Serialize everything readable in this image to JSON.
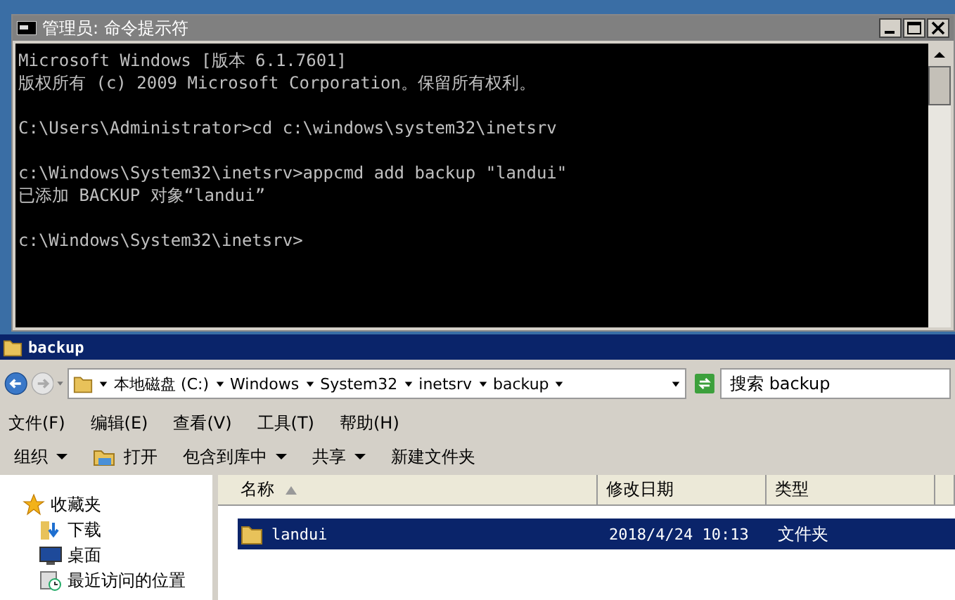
{
  "cmd_window": {
    "title": "管理员: 命令提示符",
    "blocks": [
      [
        "Microsoft Windows [版本 6.1.7601]",
        "版权所有 (c) 2009 Microsoft Corporation。保留所有权利。"
      ],
      [
        "C:\\Users\\Administrator>cd c:\\windows\\system32\\inetsrv"
      ],
      [
        "c:\\Windows\\System32\\inetsrv>appcmd add backup \"landui\"",
        "已添加 BACKUP 对象“landui”"
      ],
      [
        "c:\\Windows\\System32\\inetsrv>"
      ]
    ]
  },
  "explorer": {
    "title": "backup",
    "nav_buttons": [
      {
        "kind": "back",
        "disabled": false
      },
      {
        "kind": "forward",
        "disabled": true
      }
    ],
    "breadcrumb": [
      "本地磁盘 (C:)",
      "Windows",
      "System32",
      "inetsrv",
      "backup"
    ],
    "search": {
      "placeholder": "搜索 backup"
    },
    "menu": [
      "文件(F)",
      "编辑(E)",
      "查看(V)",
      "工具(T)",
      "帮助(H)"
    ],
    "toolbar": [
      {
        "label": "组织",
        "kind": "dropdown"
      },
      {
        "label": "打开",
        "kind": "icon"
      },
      {
        "label": "包含到库中",
        "kind": "dropdown"
      },
      {
        "label": "共享",
        "kind": "dropdown"
      },
      {
        "label": "新建文件夹",
        "kind": "plain"
      }
    ],
    "sidebar": {
      "header": "收藏夹",
      "items": [
        {
          "label": "下载",
          "kind": "download"
        },
        {
          "label": "桌面",
          "kind": "desktop"
        },
        {
          "label": "最近访问的位置",
          "kind": "recent"
        }
      ]
    },
    "table": {
      "columns": [
        {
          "label": "名称",
          "sorted": true
        },
        {
          "label": "修改日期",
          "sorted": false
        },
        {
          "label": "类型",
          "sorted": false
        }
      ],
      "rows": [
        {
          "name": "landui",
          "date": "2018/4/24 10:13",
          "type": "文件夹",
          "selected": true
        }
      ]
    }
  }
}
